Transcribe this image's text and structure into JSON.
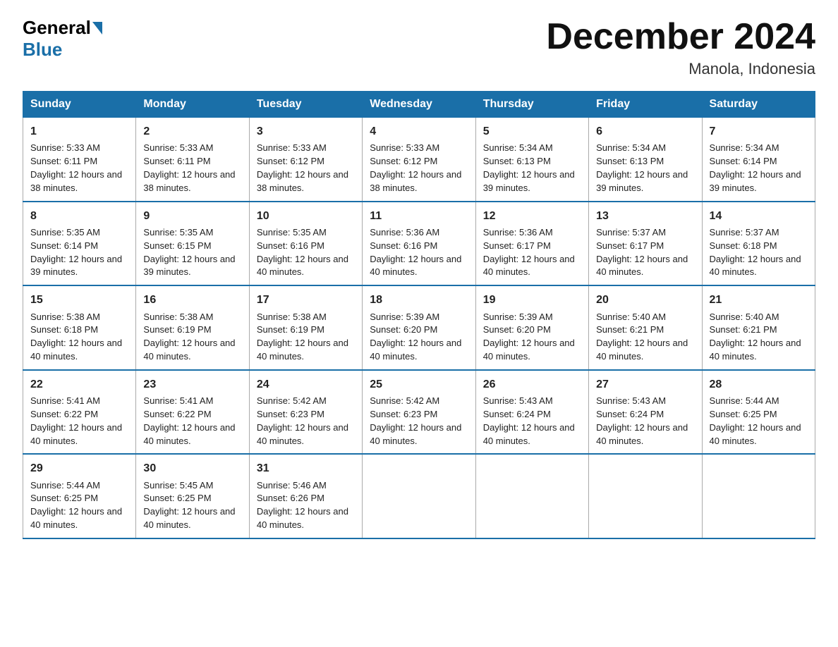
{
  "logo": {
    "general": "General",
    "blue": "Blue"
  },
  "title": "December 2024",
  "location": "Manola, Indonesia",
  "days_of_week": [
    "Sunday",
    "Monday",
    "Tuesday",
    "Wednesday",
    "Thursday",
    "Friday",
    "Saturday"
  ],
  "weeks": [
    [
      {
        "day": "1",
        "sunrise": "5:33 AM",
        "sunset": "6:11 PM",
        "daylight": "12 hours and 38 minutes."
      },
      {
        "day": "2",
        "sunrise": "5:33 AM",
        "sunset": "6:11 PM",
        "daylight": "12 hours and 38 minutes."
      },
      {
        "day": "3",
        "sunrise": "5:33 AM",
        "sunset": "6:12 PM",
        "daylight": "12 hours and 38 minutes."
      },
      {
        "day": "4",
        "sunrise": "5:33 AM",
        "sunset": "6:12 PM",
        "daylight": "12 hours and 38 minutes."
      },
      {
        "day": "5",
        "sunrise": "5:34 AM",
        "sunset": "6:13 PM",
        "daylight": "12 hours and 39 minutes."
      },
      {
        "day": "6",
        "sunrise": "5:34 AM",
        "sunset": "6:13 PM",
        "daylight": "12 hours and 39 minutes."
      },
      {
        "day": "7",
        "sunrise": "5:34 AM",
        "sunset": "6:14 PM",
        "daylight": "12 hours and 39 minutes."
      }
    ],
    [
      {
        "day": "8",
        "sunrise": "5:35 AM",
        "sunset": "6:14 PM",
        "daylight": "12 hours and 39 minutes."
      },
      {
        "day": "9",
        "sunrise": "5:35 AM",
        "sunset": "6:15 PM",
        "daylight": "12 hours and 39 minutes."
      },
      {
        "day": "10",
        "sunrise": "5:35 AM",
        "sunset": "6:16 PM",
        "daylight": "12 hours and 40 minutes."
      },
      {
        "day": "11",
        "sunrise": "5:36 AM",
        "sunset": "6:16 PM",
        "daylight": "12 hours and 40 minutes."
      },
      {
        "day": "12",
        "sunrise": "5:36 AM",
        "sunset": "6:17 PM",
        "daylight": "12 hours and 40 minutes."
      },
      {
        "day": "13",
        "sunrise": "5:37 AM",
        "sunset": "6:17 PM",
        "daylight": "12 hours and 40 minutes."
      },
      {
        "day": "14",
        "sunrise": "5:37 AM",
        "sunset": "6:18 PM",
        "daylight": "12 hours and 40 minutes."
      }
    ],
    [
      {
        "day": "15",
        "sunrise": "5:38 AM",
        "sunset": "6:18 PM",
        "daylight": "12 hours and 40 minutes."
      },
      {
        "day": "16",
        "sunrise": "5:38 AM",
        "sunset": "6:19 PM",
        "daylight": "12 hours and 40 minutes."
      },
      {
        "day": "17",
        "sunrise": "5:38 AM",
        "sunset": "6:19 PM",
        "daylight": "12 hours and 40 minutes."
      },
      {
        "day": "18",
        "sunrise": "5:39 AM",
        "sunset": "6:20 PM",
        "daylight": "12 hours and 40 minutes."
      },
      {
        "day": "19",
        "sunrise": "5:39 AM",
        "sunset": "6:20 PM",
        "daylight": "12 hours and 40 minutes."
      },
      {
        "day": "20",
        "sunrise": "5:40 AM",
        "sunset": "6:21 PM",
        "daylight": "12 hours and 40 minutes."
      },
      {
        "day": "21",
        "sunrise": "5:40 AM",
        "sunset": "6:21 PM",
        "daylight": "12 hours and 40 minutes."
      }
    ],
    [
      {
        "day": "22",
        "sunrise": "5:41 AM",
        "sunset": "6:22 PM",
        "daylight": "12 hours and 40 minutes."
      },
      {
        "day": "23",
        "sunrise": "5:41 AM",
        "sunset": "6:22 PM",
        "daylight": "12 hours and 40 minutes."
      },
      {
        "day": "24",
        "sunrise": "5:42 AM",
        "sunset": "6:23 PM",
        "daylight": "12 hours and 40 minutes."
      },
      {
        "day": "25",
        "sunrise": "5:42 AM",
        "sunset": "6:23 PM",
        "daylight": "12 hours and 40 minutes."
      },
      {
        "day": "26",
        "sunrise": "5:43 AM",
        "sunset": "6:24 PM",
        "daylight": "12 hours and 40 minutes."
      },
      {
        "day": "27",
        "sunrise": "5:43 AM",
        "sunset": "6:24 PM",
        "daylight": "12 hours and 40 minutes."
      },
      {
        "day": "28",
        "sunrise": "5:44 AM",
        "sunset": "6:25 PM",
        "daylight": "12 hours and 40 minutes."
      }
    ],
    [
      {
        "day": "29",
        "sunrise": "5:44 AM",
        "sunset": "6:25 PM",
        "daylight": "12 hours and 40 minutes."
      },
      {
        "day": "30",
        "sunrise": "5:45 AM",
        "sunset": "6:25 PM",
        "daylight": "12 hours and 40 minutes."
      },
      {
        "day": "31",
        "sunrise": "5:46 AM",
        "sunset": "6:26 PM",
        "daylight": "12 hours and 40 minutes."
      },
      null,
      null,
      null,
      null
    ]
  ],
  "labels": {
    "sunrise": "Sunrise:",
    "sunset": "Sunset:",
    "daylight": "Daylight:"
  }
}
